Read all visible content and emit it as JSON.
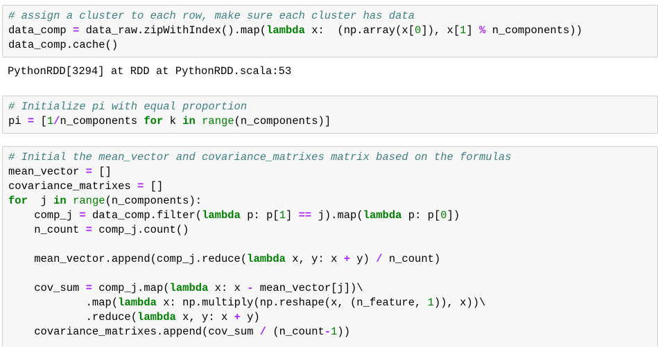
{
  "cells": [
    {
      "lines": [
        [
          {
            "t": "# assign a cluster to each row, make sure each cluster has data",
            "c": "c"
          }
        ],
        [
          {
            "t": "data_comp "
          },
          {
            "t": "=",
            "c": "o"
          },
          {
            "t": " data_raw.zipWithIndex().map("
          },
          {
            "t": "lambda",
            "c": "k"
          },
          {
            "t": " x:  (np.array(x["
          },
          {
            "t": "0",
            "c": "m"
          },
          {
            "t": "]), x["
          },
          {
            "t": "1",
            "c": "m"
          },
          {
            "t": "] "
          },
          {
            "t": "%",
            "c": "o"
          },
          {
            "t": " n_components))"
          }
        ],
        [
          {
            "t": "data_comp.cache()"
          }
        ]
      ],
      "output": "PythonRDD[3294] at RDD at PythonRDD.scala:53"
    },
    {
      "lines": [
        [
          {
            "t": "# Initialize pi with equal proportion",
            "c": "c"
          }
        ],
        [
          {
            "t": "pi "
          },
          {
            "t": "=",
            "c": "o"
          },
          {
            "t": " ["
          },
          {
            "t": "1",
            "c": "m"
          },
          {
            "t": "/",
            "c": "o"
          },
          {
            "t": "n_components "
          },
          {
            "t": "for",
            "c": "k"
          },
          {
            "t": " k "
          },
          {
            "t": "in",
            "c": "k"
          },
          {
            "t": " "
          },
          {
            "t": "range",
            "c": "nb"
          },
          {
            "t": "(n_components)]"
          }
        ]
      ]
    },
    {
      "lines": [
        [
          {
            "t": "# Initial the mean_vector and covariance_matrixes matrix based on the formulas",
            "c": "c"
          }
        ],
        [
          {
            "t": "mean_vector "
          },
          {
            "t": "=",
            "c": "o"
          },
          {
            "t": " []"
          }
        ],
        [
          {
            "t": "covariance_matrixes "
          },
          {
            "t": "=",
            "c": "o"
          },
          {
            "t": " []"
          }
        ],
        [
          {
            "t": "for",
            "c": "k"
          },
          {
            "t": "  j "
          },
          {
            "t": "in",
            "c": "k"
          },
          {
            "t": " "
          },
          {
            "t": "range",
            "c": "nb"
          },
          {
            "t": "(n_components):"
          }
        ],
        [
          {
            "t": "    comp_j "
          },
          {
            "t": "=",
            "c": "o"
          },
          {
            "t": " data_comp.filter("
          },
          {
            "t": "lambda",
            "c": "k"
          },
          {
            "t": " p: p["
          },
          {
            "t": "1",
            "c": "m"
          },
          {
            "t": "] "
          },
          {
            "t": "==",
            "c": "o"
          },
          {
            "t": " j).map("
          },
          {
            "t": "lambda",
            "c": "k"
          },
          {
            "t": " p: p["
          },
          {
            "t": "0",
            "c": "m"
          },
          {
            "t": "])"
          }
        ],
        [
          {
            "t": "    n_count "
          },
          {
            "t": "=",
            "c": "o"
          },
          {
            "t": " comp_j.count()"
          }
        ],
        [
          {
            "t": ""
          }
        ],
        [
          {
            "t": "    mean_vector.append(comp_j.reduce("
          },
          {
            "t": "lambda",
            "c": "k"
          },
          {
            "t": " x, y: x "
          },
          {
            "t": "+",
            "c": "o"
          },
          {
            "t": " y) "
          },
          {
            "t": "/",
            "c": "o"
          },
          {
            "t": " n_count)"
          }
        ],
        [
          {
            "t": ""
          }
        ],
        [
          {
            "t": "    cov_sum "
          },
          {
            "t": "=",
            "c": "o"
          },
          {
            "t": " comp_j.map("
          },
          {
            "t": "lambda",
            "c": "k"
          },
          {
            "t": " x: x "
          },
          {
            "t": "-",
            "c": "o"
          },
          {
            "t": " mean_vector[j])\\"
          }
        ],
        [
          {
            "t": "            .map("
          },
          {
            "t": "lambda",
            "c": "k"
          },
          {
            "t": " x: np.multiply(np.reshape(x, (n_feature, "
          },
          {
            "t": "1",
            "c": "m"
          },
          {
            "t": ")), x))\\"
          }
        ],
        [
          {
            "t": "            .reduce("
          },
          {
            "t": "lambda",
            "c": "k"
          },
          {
            "t": " x, y: x "
          },
          {
            "t": "+",
            "c": "o"
          },
          {
            "t": " y)"
          }
        ],
        [
          {
            "t": "    covariance_matrixes.append(cov_sum "
          },
          {
            "t": "/",
            "c": "o"
          },
          {
            "t": " (n_count"
          },
          {
            "t": "-",
            "c": "o"
          },
          {
            "t": "1",
            "c": "m"
          },
          {
            "t": "))"
          }
        ]
      ]
    }
  ]
}
